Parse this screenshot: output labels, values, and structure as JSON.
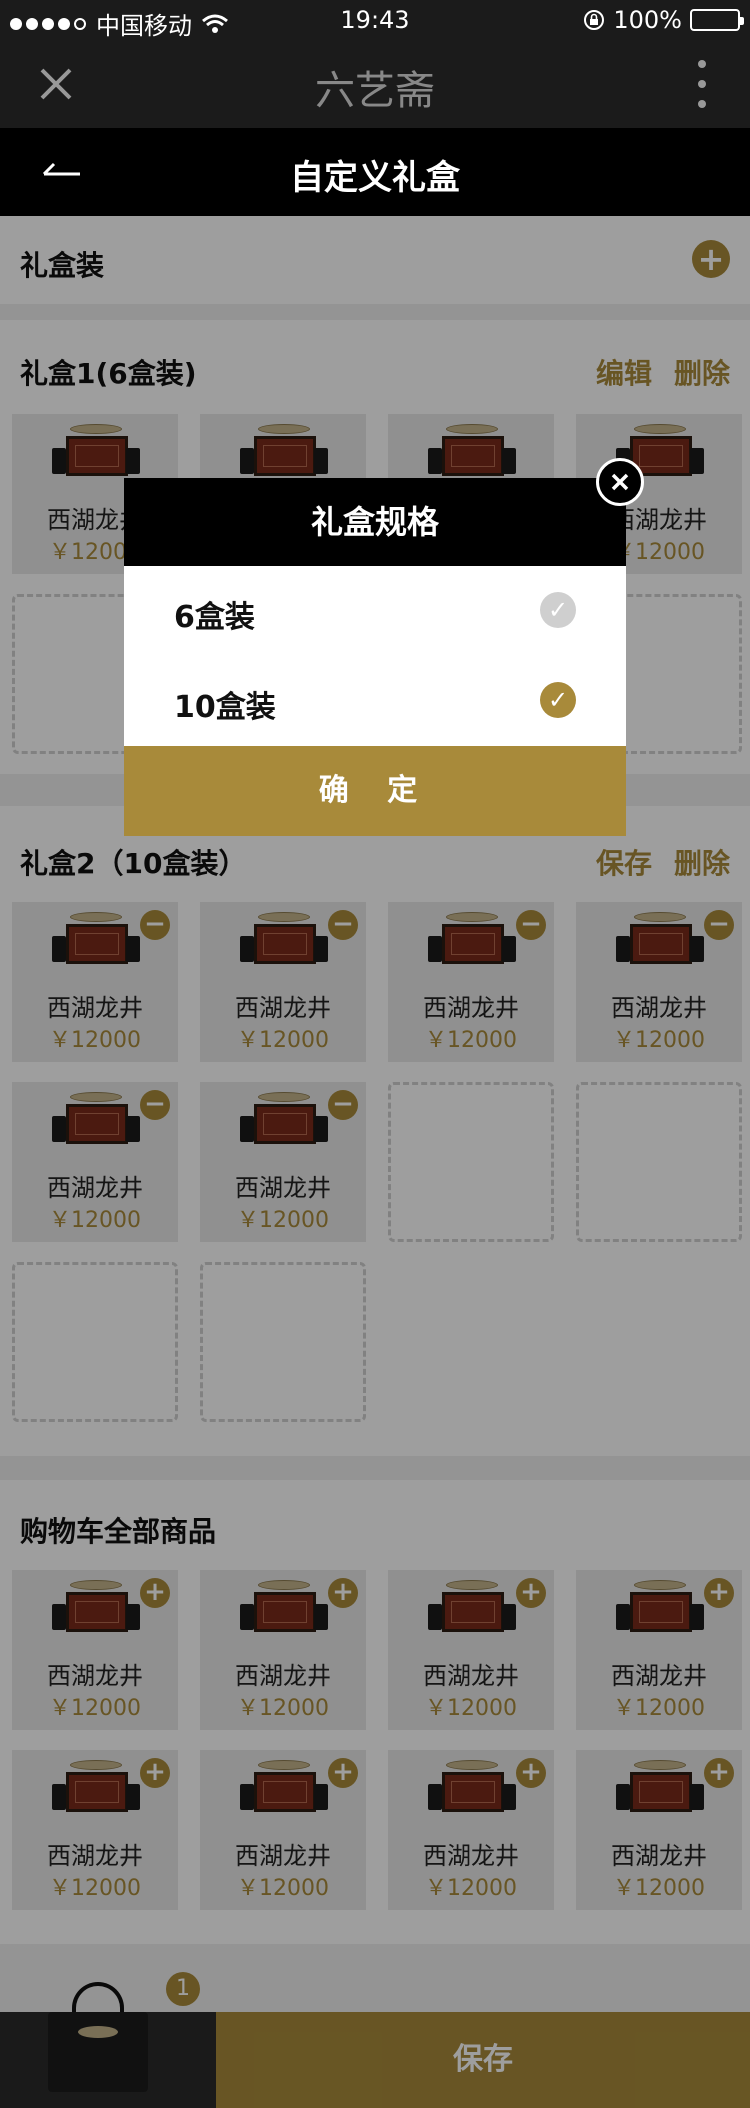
{
  "status_bar": {
    "carrier": "中国移动",
    "time": "19:43",
    "battery": "100%"
  },
  "app_bar": {
    "title": "六艺斋"
  },
  "page_header": {
    "title": "自定义礼盒"
  },
  "gift_section": {
    "title": "礼盒装"
  },
  "box1": {
    "title": "礼盒1(6盒装)",
    "edit_label": "编辑",
    "delete_label": "删除"
  },
  "box2": {
    "title": "礼盒2（10盒装）",
    "save_label": "保存",
    "delete_label": "删除"
  },
  "cart_section": {
    "title": "购物车全部商品"
  },
  "product": {
    "name": "西湖龙井",
    "price": "￥12000"
  },
  "modal": {
    "title": "礼盒规格",
    "options": [
      {
        "label": "6盒装",
        "selected": false
      },
      {
        "label": "10盒装",
        "selected": true
      }
    ],
    "confirm_label": "确 定"
  },
  "bottom_bar": {
    "cart_count": "1",
    "save_label": "保存"
  },
  "colors": {
    "accent": "#a88a3a",
    "dark": "#1b1b1b",
    "overlay": "rgba(0,0,0,0.38)"
  }
}
